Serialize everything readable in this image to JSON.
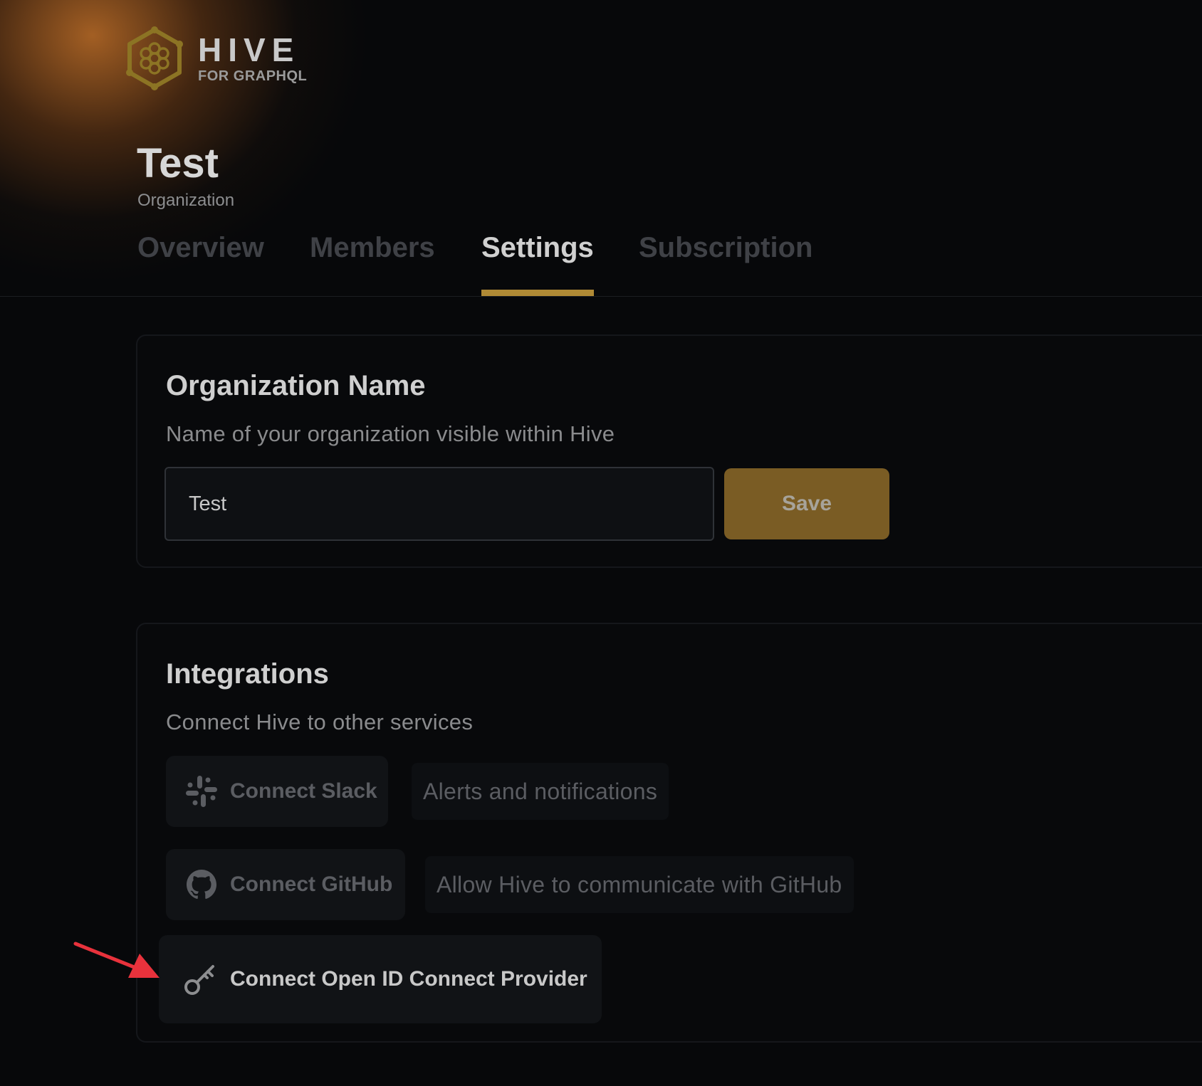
{
  "brand": {
    "name": "HIVE",
    "tagline": "FOR GRAPHQL",
    "accent_color": "#b08a35"
  },
  "organization": {
    "name": "Test",
    "type_label": "Organization"
  },
  "tabs": [
    {
      "label": "Overview",
      "active": false
    },
    {
      "label": "Members",
      "active": false
    },
    {
      "label": "Settings",
      "active": true
    },
    {
      "label": "Subscription",
      "active": false
    }
  ],
  "org_name_section": {
    "title": "Organization Name",
    "description": "Name of your organization visible within Hive",
    "input_value": "Test",
    "save_label": "Save"
  },
  "integrations_section": {
    "title": "Integrations",
    "description": "Connect Hive to other services",
    "items": [
      {
        "button_label": "Connect Slack",
        "icon": "slack-icon",
        "note": "Alerts and notifications"
      },
      {
        "button_label": "Connect GitHub",
        "icon": "github-icon",
        "note": "Allow Hive to communicate with GitHub"
      },
      {
        "button_label": "Connect Open ID Connect Provider",
        "icon": "key-icon"
      }
    ]
  },
  "annotation": {
    "arrow_color": "#e8323c",
    "points_to": "Connect Open ID Connect Provider"
  }
}
